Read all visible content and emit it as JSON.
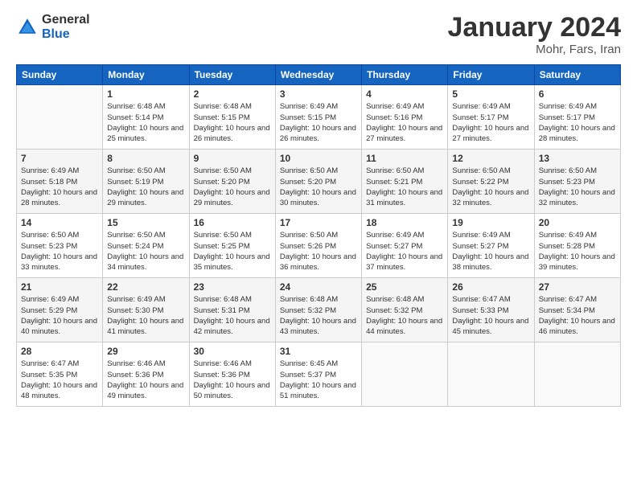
{
  "logo": {
    "general": "General",
    "blue": "Blue"
  },
  "header": {
    "month": "January 2024",
    "location": "Mohr, Fars, Iran"
  },
  "weekdays": [
    "Sunday",
    "Monday",
    "Tuesday",
    "Wednesday",
    "Thursday",
    "Friday",
    "Saturday"
  ],
  "weeks": [
    [
      {
        "day": "",
        "sunrise": "",
        "sunset": "",
        "daylight": ""
      },
      {
        "day": "1",
        "sunrise": "6:48 AM",
        "sunset": "5:14 PM",
        "daylight": "10 hours and 25 minutes."
      },
      {
        "day": "2",
        "sunrise": "6:48 AM",
        "sunset": "5:15 PM",
        "daylight": "10 hours and 26 minutes."
      },
      {
        "day": "3",
        "sunrise": "6:49 AM",
        "sunset": "5:15 PM",
        "daylight": "10 hours and 26 minutes."
      },
      {
        "day": "4",
        "sunrise": "6:49 AM",
        "sunset": "5:16 PM",
        "daylight": "10 hours and 27 minutes."
      },
      {
        "day": "5",
        "sunrise": "6:49 AM",
        "sunset": "5:17 PM",
        "daylight": "10 hours and 27 minutes."
      },
      {
        "day": "6",
        "sunrise": "6:49 AM",
        "sunset": "5:17 PM",
        "daylight": "10 hours and 28 minutes."
      }
    ],
    [
      {
        "day": "7",
        "sunrise": "6:49 AM",
        "sunset": "5:18 PM",
        "daylight": "10 hours and 28 minutes."
      },
      {
        "day": "8",
        "sunrise": "6:50 AM",
        "sunset": "5:19 PM",
        "daylight": "10 hours and 29 minutes."
      },
      {
        "day": "9",
        "sunrise": "6:50 AM",
        "sunset": "5:20 PM",
        "daylight": "10 hours and 29 minutes."
      },
      {
        "day": "10",
        "sunrise": "6:50 AM",
        "sunset": "5:20 PM",
        "daylight": "10 hours and 30 minutes."
      },
      {
        "day": "11",
        "sunrise": "6:50 AM",
        "sunset": "5:21 PM",
        "daylight": "10 hours and 31 minutes."
      },
      {
        "day": "12",
        "sunrise": "6:50 AM",
        "sunset": "5:22 PM",
        "daylight": "10 hours and 32 minutes."
      },
      {
        "day": "13",
        "sunrise": "6:50 AM",
        "sunset": "5:23 PM",
        "daylight": "10 hours and 32 minutes."
      }
    ],
    [
      {
        "day": "14",
        "sunrise": "6:50 AM",
        "sunset": "5:23 PM",
        "daylight": "10 hours and 33 minutes."
      },
      {
        "day": "15",
        "sunrise": "6:50 AM",
        "sunset": "5:24 PM",
        "daylight": "10 hours and 34 minutes."
      },
      {
        "day": "16",
        "sunrise": "6:50 AM",
        "sunset": "5:25 PM",
        "daylight": "10 hours and 35 minutes."
      },
      {
        "day": "17",
        "sunrise": "6:50 AM",
        "sunset": "5:26 PM",
        "daylight": "10 hours and 36 minutes."
      },
      {
        "day": "18",
        "sunrise": "6:49 AM",
        "sunset": "5:27 PM",
        "daylight": "10 hours and 37 minutes."
      },
      {
        "day": "19",
        "sunrise": "6:49 AM",
        "sunset": "5:27 PM",
        "daylight": "10 hours and 38 minutes."
      },
      {
        "day": "20",
        "sunrise": "6:49 AM",
        "sunset": "5:28 PM",
        "daylight": "10 hours and 39 minutes."
      }
    ],
    [
      {
        "day": "21",
        "sunrise": "6:49 AM",
        "sunset": "5:29 PM",
        "daylight": "10 hours and 40 minutes."
      },
      {
        "day": "22",
        "sunrise": "6:49 AM",
        "sunset": "5:30 PM",
        "daylight": "10 hours and 41 minutes."
      },
      {
        "day": "23",
        "sunrise": "6:48 AM",
        "sunset": "5:31 PM",
        "daylight": "10 hours and 42 minutes."
      },
      {
        "day": "24",
        "sunrise": "6:48 AM",
        "sunset": "5:32 PM",
        "daylight": "10 hours and 43 minutes."
      },
      {
        "day": "25",
        "sunrise": "6:48 AM",
        "sunset": "5:32 PM",
        "daylight": "10 hours and 44 minutes."
      },
      {
        "day": "26",
        "sunrise": "6:47 AM",
        "sunset": "5:33 PM",
        "daylight": "10 hours and 45 minutes."
      },
      {
        "day": "27",
        "sunrise": "6:47 AM",
        "sunset": "5:34 PM",
        "daylight": "10 hours and 46 minutes."
      }
    ],
    [
      {
        "day": "28",
        "sunrise": "6:47 AM",
        "sunset": "5:35 PM",
        "daylight": "10 hours and 48 minutes."
      },
      {
        "day": "29",
        "sunrise": "6:46 AM",
        "sunset": "5:36 PM",
        "daylight": "10 hours and 49 minutes."
      },
      {
        "day": "30",
        "sunrise": "6:46 AM",
        "sunset": "5:36 PM",
        "daylight": "10 hours and 50 minutes."
      },
      {
        "day": "31",
        "sunrise": "6:45 AM",
        "sunset": "5:37 PM",
        "daylight": "10 hours and 51 minutes."
      },
      {
        "day": "",
        "sunrise": "",
        "sunset": "",
        "daylight": ""
      },
      {
        "day": "",
        "sunrise": "",
        "sunset": "",
        "daylight": ""
      },
      {
        "day": "",
        "sunrise": "",
        "sunset": "",
        "daylight": ""
      }
    ]
  ],
  "labels": {
    "sunrise": "Sunrise:",
    "sunset": "Sunset:",
    "daylight": "Daylight:"
  }
}
